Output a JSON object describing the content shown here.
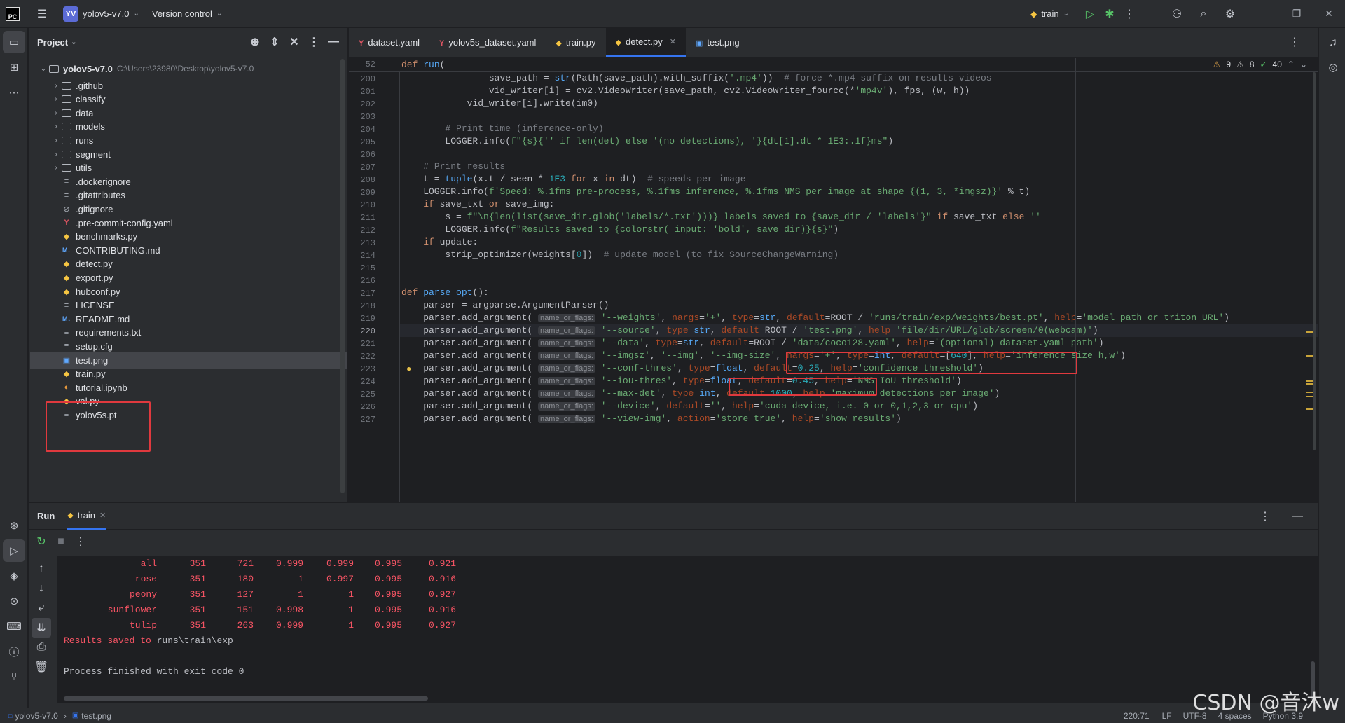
{
  "titlebar": {
    "app_icon": "pycharm-logo",
    "project_badge": "YV",
    "project_name": "yolov5-v7.0",
    "vcs": "Version control",
    "run_config": "train"
  },
  "project_panel": {
    "title": "Project",
    "root_name": "yolov5-v7.0",
    "root_path": "C:\\Users\\23980\\Desktop\\yolov5-v7.0",
    "items": [
      {
        "name": ".github",
        "type": "folder"
      },
      {
        "name": "classify",
        "type": "folder"
      },
      {
        "name": "data",
        "type": "folder"
      },
      {
        "name": "models",
        "type": "folder"
      },
      {
        "name": "runs",
        "type": "folder"
      },
      {
        "name": "segment",
        "type": "folder"
      },
      {
        "name": "utils",
        "type": "folder"
      },
      {
        "name": ".dockerignore",
        "type": "text"
      },
      {
        "name": ".gitattributes",
        "type": "text"
      },
      {
        "name": ".gitignore",
        "type": "ignore"
      },
      {
        "name": ".pre-commit-config.yaml",
        "type": "yaml"
      },
      {
        "name": "benchmarks.py",
        "type": "python"
      },
      {
        "name": "CONTRIBUTING.md",
        "type": "markdown"
      },
      {
        "name": "detect.py",
        "type": "python"
      },
      {
        "name": "export.py",
        "type": "python"
      },
      {
        "name": "hubconf.py",
        "type": "python"
      },
      {
        "name": "LICENSE",
        "type": "text"
      },
      {
        "name": "README.md",
        "type": "markdown"
      },
      {
        "name": "requirements.txt",
        "type": "text"
      },
      {
        "name": "setup.cfg",
        "type": "text"
      },
      {
        "name": "test.png",
        "type": "image"
      },
      {
        "name": "train.py",
        "type": "python"
      },
      {
        "name": "tutorial.ipynb",
        "type": "notebook"
      },
      {
        "name": "val.py",
        "type": "python"
      },
      {
        "name": "yolov5s.pt",
        "type": "text"
      }
    ]
  },
  "tabs": [
    {
      "label": "dataset.yaml",
      "icon": "yaml-icon"
    },
    {
      "label": "yolov5s_dataset.yaml",
      "icon": "yaml-icon"
    },
    {
      "label": "train.py",
      "icon": "python-icon"
    },
    {
      "label": "detect.py",
      "icon": "python-icon",
      "active": true
    },
    {
      "label": "test.png",
      "icon": "image-icon"
    }
  ],
  "inspections": {
    "warnings": "9",
    "weak": "8",
    "ok": "40"
  },
  "editor": {
    "sticky": {
      "ln": "52",
      "code": "def run("
    },
    "lines": [
      {
        "ln": "200",
        "code": "                save_path = str(Path(save_path).with_suffix('.mp4'))  # force *.mp4 suffix on results videos"
      },
      {
        "ln": "201",
        "code": "                vid_writer[i] = cv2.VideoWriter(save_path, cv2.VideoWriter_fourcc(*'mp4v'), fps, (w, h))"
      },
      {
        "ln": "202",
        "code": "            vid_writer[i].write(im0)"
      },
      {
        "ln": "203",
        "code": ""
      },
      {
        "ln": "204",
        "code": "        # Print time (inference-only)"
      },
      {
        "ln": "205",
        "code": "        LOGGER.info(f\"{s}{'' if len(det) else '(no detections), '}{dt[1].dt * 1E3:.1f}ms\")"
      },
      {
        "ln": "206",
        "code": ""
      },
      {
        "ln": "207",
        "code": "    # Print results"
      },
      {
        "ln": "208",
        "code": "    t = tuple(x.t / seen * 1E3 for x in dt)  # speeds per image"
      },
      {
        "ln": "209",
        "code": "    LOGGER.info(f'Speed: %.1fms pre-process, %.1fms inference, %.1fms NMS per image at shape {(1, 3, *imgsz)}' % t)"
      },
      {
        "ln": "210",
        "code": "    if save_txt or save_img:"
      },
      {
        "ln": "211",
        "code": "        s = f\"\\n{len(list(save_dir.glob('labels/*.txt')))} labels saved to {save_dir / 'labels'}\" if save_txt else ''"
      },
      {
        "ln": "212",
        "code": "        LOGGER.info(f\"Results saved to {colorstr( input: 'bold', save_dir)}{s}\")"
      },
      {
        "ln": "213",
        "code": "    if update:"
      },
      {
        "ln": "214",
        "code": "        strip_optimizer(weights[0])  # update model (to fix SourceChangeWarning)"
      },
      {
        "ln": "215",
        "code": ""
      },
      {
        "ln": "216",
        "code": ""
      },
      {
        "ln": "217",
        "code": "def parse_opt():"
      },
      {
        "ln": "218",
        "code": "    parser = argparse.ArgumentParser()"
      },
      {
        "ln": "219",
        "code": "    parser.add_argument( *name_or_flags: '--weights', nargs='+', type=str, default=ROOT / 'runs/train/exp/weights/best.pt', help='model path or triton URL')"
      },
      {
        "ln": "220",
        "code": "    parser.add_argument( *name_or_flags: '--source', type=str, default=ROOT / 'test.png', help='file/dir/URL/glob/screen/0(webcam)')"
      },
      {
        "ln": "221",
        "code": "    parser.add_argument( *name_or_flags: '--data', type=str, default=ROOT / 'data/coco128.yaml', help='(optional) dataset.yaml path')"
      },
      {
        "ln": "222",
        "code": "    parser.add_argument( *name_or_flags: '--imgsz', '--img', '--img-size', nargs='+', type=int, default=[640], help='inference size h,w')"
      },
      {
        "ln": "223",
        "code": "    parser.add_argument( *name_or_flags: '--conf-thres', type=float, default=0.25, help='confidence threshold')"
      },
      {
        "ln": "224",
        "code": "    parser.add_argument( *name_or_flags: '--iou-thres', type=float, default=0.45, help='NMS IoU threshold')"
      },
      {
        "ln": "225",
        "code": "    parser.add_argument( *name_or_flags: '--max-det', type=int, default=1000, help='maximum detections per image')"
      },
      {
        "ln": "226",
        "code": "    parser.add_argument( *name_or_flags: '--device', default='', help='cuda device, i.e. 0 or 0,1,2,3 or cpu')"
      },
      {
        "ln": "227",
        "code": "    parser.add_argument( *name_or_flags: '--view-img', action='store_true', help='show results')"
      }
    ]
  },
  "run_panel": {
    "title": "Run",
    "tab_label": "train",
    "rows": [
      [
        "all",
        "351",
        "721",
        "0.999",
        "0.999",
        "0.995",
        "0.921"
      ],
      [
        "rose",
        "351",
        "180",
        "1",
        "0.997",
        "0.995",
        "0.916"
      ],
      [
        "peony",
        "351",
        "127",
        "1",
        "1",
        "0.995",
        "0.927"
      ],
      [
        "sunflower",
        "351",
        "151",
        "0.998",
        "1",
        "0.995",
        "0.916"
      ],
      [
        "tulip",
        "351",
        "263",
        "0.999",
        "1",
        "0.995",
        "0.927"
      ]
    ],
    "results_prefix": "Results saved to ",
    "results_path": "runs\\train\\exp",
    "exit_line": "Process finished with exit code 0"
  },
  "statusbar": {
    "project": "yolov5-v7.0",
    "file": "test.png",
    "position": "220:71",
    "line_sep": "LF",
    "encoding": "UTF-8",
    "indent": "4 spaces",
    "interpreter": "Python 3.9"
  },
  "watermark": "CSDN @音沐w",
  "colors": {
    "accent": "#3574f0",
    "annotation_red": "#e0393e",
    "console_red": "#f75464"
  }
}
